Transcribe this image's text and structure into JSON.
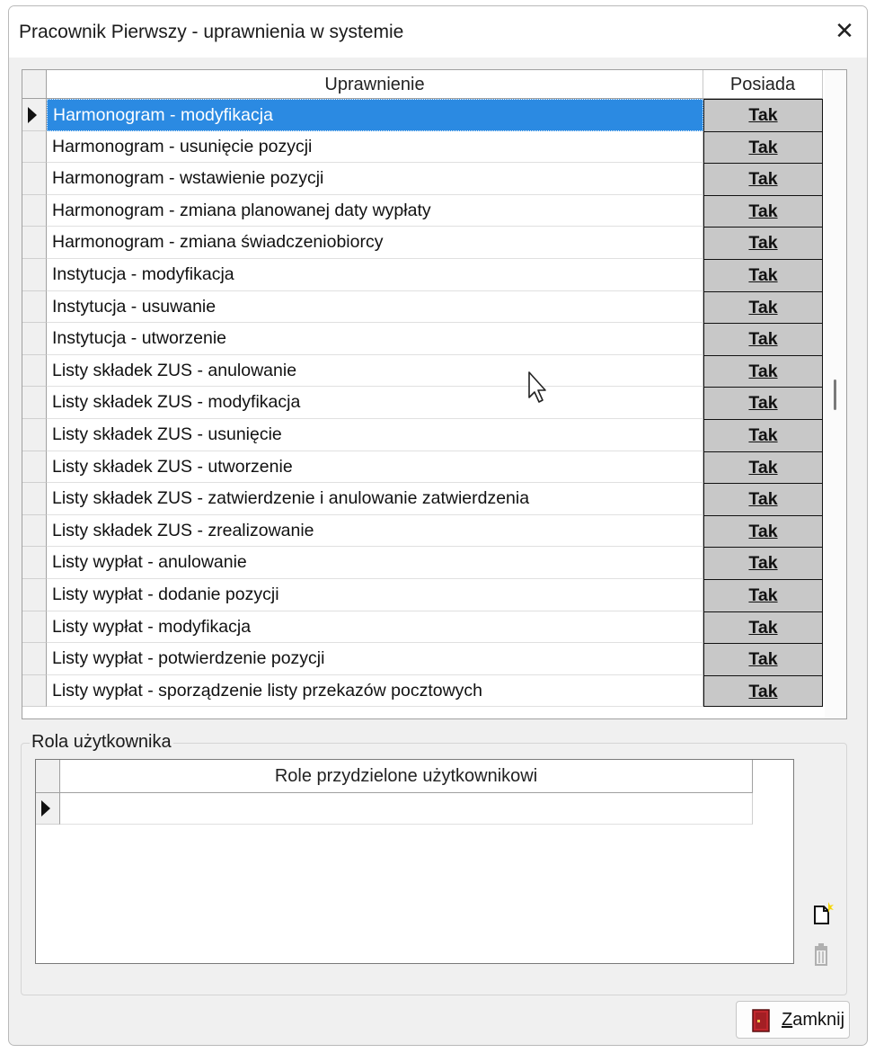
{
  "window": {
    "title": "Pracownik Pierwszy - uprawnienia w systemie",
    "close_glyph": "✕"
  },
  "permissions": {
    "header_name": "Uprawnienie",
    "header_value": "Posiada",
    "rows": [
      {
        "name": "Harmonogram - modyfikacja",
        "value": "Tak"
      },
      {
        "name": "Harmonogram - usunięcie pozycji",
        "value": "Tak"
      },
      {
        "name": "Harmonogram - wstawienie pozycji",
        "value": "Tak"
      },
      {
        "name": "Harmonogram - zmiana planowanej daty wypłaty",
        "value": "Tak"
      },
      {
        "name": "Harmonogram - zmiana świadczeniobiorcy",
        "value": "Tak"
      },
      {
        "name": "Instytucja - modyfikacja",
        "value": "Tak"
      },
      {
        "name": "Instytucja - usuwanie",
        "value": "Tak"
      },
      {
        "name": "Instytucja - utworzenie",
        "value": "Tak"
      },
      {
        "name": "Listy składek ZUS - anulowanie",
        "value": "Tak"
      },
      {
        "name": "Listy składek ZUS - modyfikacja",
        "value": "Tak"
      },
      {
        "name": "Listy składek ZUS - usunięcie",
        "value": "Tak"
      },
      {
        "name": "Listy składek ZUS - utworzenie",
        "value": "Tak"
      },
      {
        "name": "Listy składek ZUS - zatwierdzenie i anulowanie zatwierdzenia",
        "value": "Tak"
      },
      {
        "name": "Listy składek ZUS - zrealizowanie",
        "value": "Tak"
      },
      {
        "name": "Listy wypłat - anulowanie",
        "value": "Tak"
      },
      {
        "name": "Listy wypłat - dodanie pozycji",
        "value": "Tak"
      },
      {
        "name": "Listy wypłat - modyfikacja",
        "value": "Tak"
      },
      {
        "name": "Listy wypłat - potwierdzenie pozycji",
        "value": "Tak"
      },
      {
        "name": "Listy wypłat - sporządzenie listy przekazów pocztowych",
        "value": "Tak"
      }
    ],
    "selected_index": 0
  },
  "roles": {
    "group_label": "Rola użytkownika",
    "header": "Role przydzielone użytkownikowi",
    "new_icon": "new-document-icon",
    "delete_icon": "trash-icon"
  },
  "footer": {
    "close_accel": "Z",
    "close_rest": "amknij",
    "close_icon": "door-icon"
  },
  "colors": {
    "selection": "#2b8ae2",
    "value_cell": "#c8c8c8",
    "door": "#c0272d"
  }
}
